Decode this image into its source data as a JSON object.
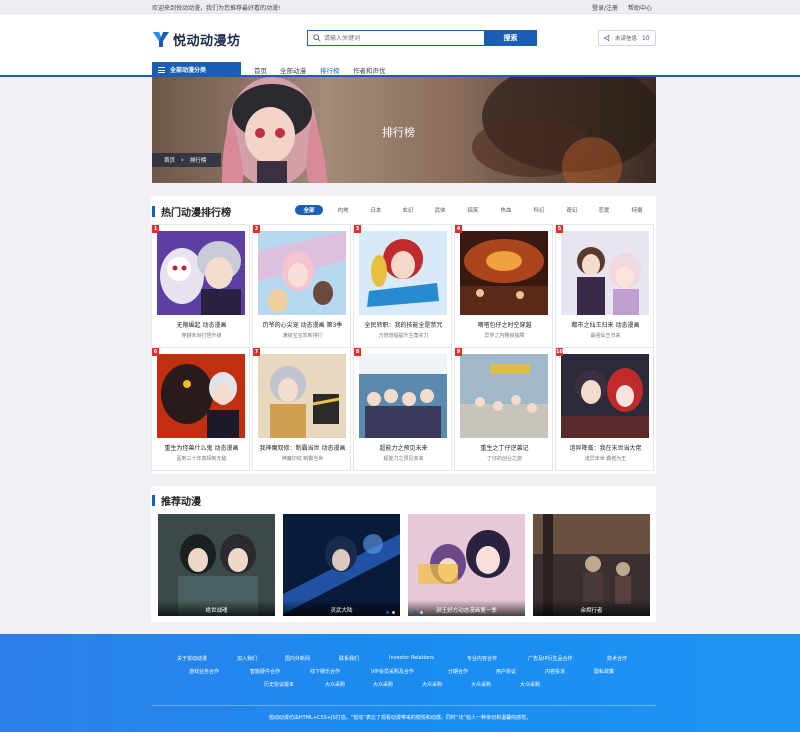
{
  "topbar": {
    "welcome": "欢迎来到悦动动漫，我们为您推荐最好看的动漫!",
    "login": "登录/注册",
    "help": "帮助中心"
  },
  "header": {
    "logo_text": "悦动动漫坊",
    "search_placeholder": "请输入关键词",
    "search_button": "搜索",
    "msg_label": "未读信息",
    "msg_count": "10"
  },
  "nav": {
    "category_label": "全部动漫分类",
    "items": [
      "首页",
      "全部动漫",
      "排行榜",
      "作者和声优"
    ],
    "active_index": 2
  },
  "banner": {
    "title": "排行榜",
    "crumb_home": "首页",
    "crumb_current": "排行榜"
  },
  "hot": {
    "title": "热门动漫排行榜",
    "tabs": [
      "全部",
      "内地",
      "日本",
      "玄幻",
      "武侠",
      "搞笑",
      "热血",
      "科幻",
      "奇幻",
      "恋爱",
      "特摄"
    ],
    "active_tab": 0,
    "cards": [
      {
        "rank": "1",
        "title": "无限崛起 动态漫画",
        "sub": "穿越未世打怪升级"
      },
      {
        "rank": "2",
        "title": "历爷的心尖宠 动态漫画 第3季",
        "sub": "满级宝宝驾到排行"
      },
      {
        "rank": "3",
        "title": "全民转职：我的技能全是禁咒",
        "sub": "万倍增幅提升主角实力"
      },
      {
        "rank": "4",
        "title": "嘀嗒包仔之时空穿越",
        "sub": "异界之内略良独障"
      },
      {
        "rank": "5",
        "title": "都市之仙王归来 动态漫画",
        "sub": "最强仙王归来"
      },
      {
        "rank": "6",
        "title": "重生为怪兽什么鬼 动态漫画",
        "sub": "歪到三十年真相到无敌"
      },
      {
        "rank": "7",
        "title": "我神魔双修：制霸当世 动态漫画",
        "sub": "神魔印纹 制霸当世"
      },
      {
        "rank": "8",
        "title": "超能力之预见未来",
        "sub": "超能力之预见未来"
      },
      {
        "rank": "9",
        "title": "重生之丁仔逆袭记",
        "sub": "丁仔的创业之旅"
      },
      {
        "rank": "10",
        "title": "谙异降临：我在末世当大佬",
        "sub": "谙异末世 霸者为王"
      }
    ]
  },
  "recommend": {
    "title": "推荐动漫",
    "items": [
      {
        "caption": "绝世战魂"
      },
      {
        "caption": "灵武大陆"
      },
      {
        "caption": "颜王好方动态漫画第一季"
      },
      {
        "caption": "余烬行者"
      }
    ]
  },
  "footer": {
    "row1": [
      "关于悦动动漫",
      "加入我们",
      "国内外新闻",
      "联系我们",
      "Investor Relations",
      "专业内容合作",
      "广告及IP衍生品合作",
      "技术合作"
    ],
    "row2": [
      "游戏业务合作",
      "智能硬件合作",
      "线下娱乐合作",
      "VIP会员采购及合作",
      "分期合作",
      "用户协议",
      "内容投诉",
      "隐私政策"
    ],
    "row3": [
      "历史协议版本",
      "大众采购",
      "大众采购",
      "大众采购",
      "大众采购",
      "大众采购"
    ],
    "copyright": "悦动动漫坊由HTML+CSS+JS打造。“悦动”表达了观看动漫带来的愉悦和动感。同时“坊”给人一种亲切和温馨的感觉。"
  },
  "colors": {
    "accent": "#1a5fb4",
    "rank_badge": "#e03030",
    "footer": "#1a8cf0"
  }
}
